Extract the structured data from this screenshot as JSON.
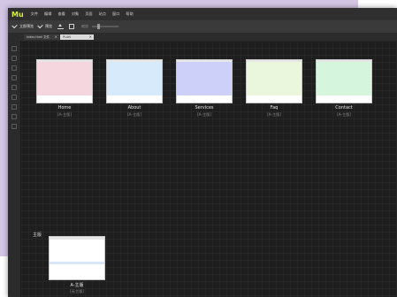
{
  "window": {
    "logo": "Mu"
  },
  "menu": [
    "文件",
    "编辑",
    "查看",
    "对象",
    "页面",
    "站点",
    "窗口",
    "帮助"
  ],
  "toolbar": {
    "check1": "立即预览",
    "check2": "预览",
    "zoom_label": "缩放"
  },
  "tabs": [
    {
      "label": "index.html 文件"
    },
    {
      "label": "PLAN"
    }
  ],
  "pages": [
    {
      "name": "Home",
      "master": "[A-主版]",
      "color": "#f5d6de"
    },
    {
      "name": "About",
      "master": "[A-主版]",
      "color": "#d7eafc"
    },
    {
      "name": "Services",
      "master": "[A-主版]",
      "color": "#cdd0f8"
    },
    {
      "name": "Faq",
      "master": "[A-主版]",
      "color": "#eaf7dc"
    },
    {
      "name": "Contact",
      "master": "[A-主版]",
      "color": "#d5f6dd"
    }
  ],
  "masters_section": {
    "heading": "主版",
    "items": [
      {
        "name": "A-主版",
        "master": "[无主版]"
      }
    ]
  }
}
